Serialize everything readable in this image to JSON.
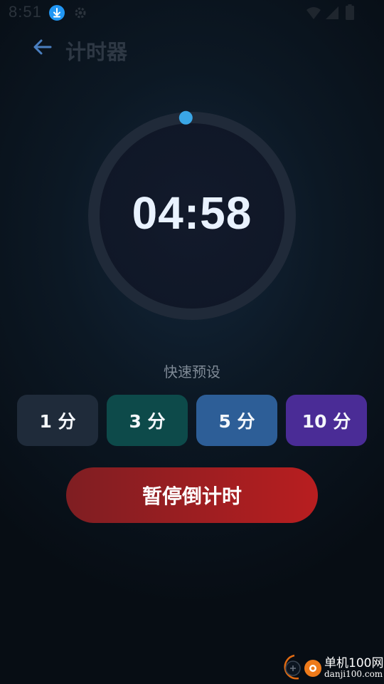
{
  "status_bar": {
    "time": "8:51",
    "icons": [
      "download-icon",
      "settings-icon",
      "wifi-icon",
      "signal-icon",
      "battery-icon"
    ]
  },
  "header": {
    "back_icon": "arrow-left-icon",
    "title": "计时器"
  },
  "timer": {
    "display": "04:58",
    "progress_fraction": 0.99,
    "ring_color": "#202a39",
    "indicator_color": "#3aa6e6"
  },
  "presets": {
    "label": "快速预设",
    "buttons": [
      {
        "label": "1 分",
        "color": "#1f2b3a"
      },
      {
        "label": "3 分",
        "color": "#0d4a4a"
      },
      {
        "label": "5 分",
        "color": "#2d5e97"
      },
      {
        "label": "10 分",
        "color": "#4a2c96"
      }
    ]
  },
  "action": {
    "pause_label": "暂停倒计时",
    "color_start": "#7f1e22",
    "color_end": "#b81e20"
  },
  "watermark": {
    "brand": "单机100网",
    "url": "danji100.com"
  }
}
